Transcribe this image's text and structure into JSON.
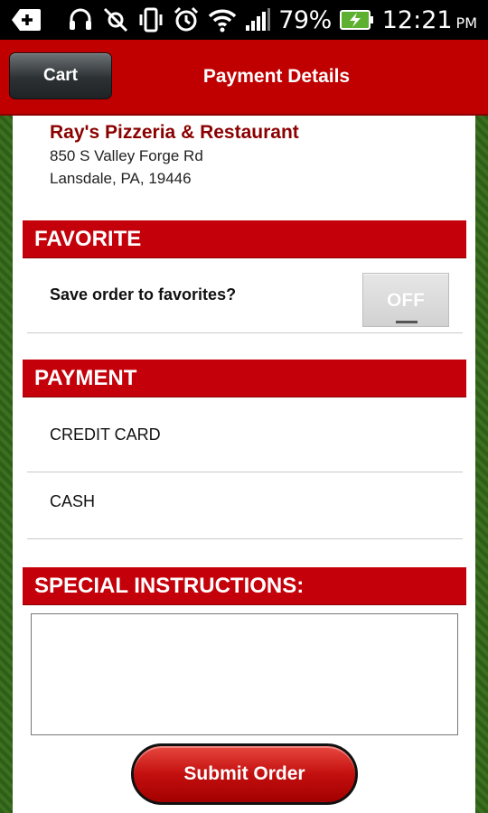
{
  "status_bar": {
    "battery_percent": "79%",
    "time": "12:21",
    "ampm": "PM"
  },
  "header": {
    "back_button_label": "Cart",
    "title": "Payment Details"
  },
  "restaurant": {
    "name": "Ray's Pizzeria & Restaurant",
    "address_line1": "850 S Valley Forge Rd",
    "address_line2": "Lansdale, PA, 19446"
  },
  "favorite": {
    "header": "FAVORITE",
    "save_label": "Save order to favorites?",
    "toggle_state": "OFF"
  },
  "payment": {
    "header": "PAYMENT",
    "options": [
      "CREDIT CARD",
      "CASH"
    ]
  },
  "special": {
    "header": "SPECIAL INSTRUCTIONS:",
    "value": ""
  },
  "submit_label": "Submit Order",
  "colors": {
    "brand_red": "#c4000a",
    "header_red": "#c00000",
    "dark_text_red": "#8b0000"
  }
}
